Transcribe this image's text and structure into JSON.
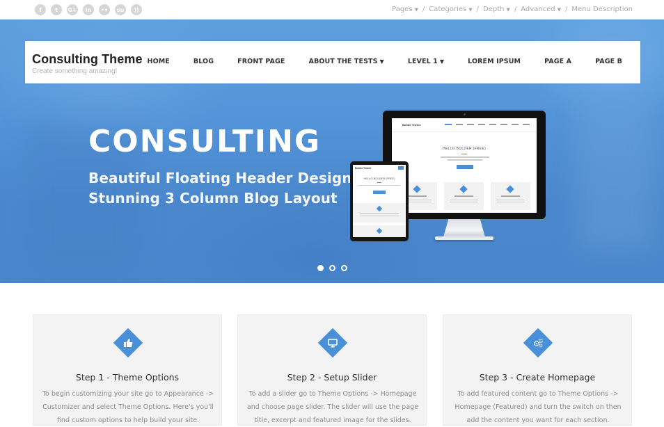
{
  "topbar": {
    "social_icons": [
      {
        "name": "facebook-icon",
        "glyph": "f"
      },
      {
        "name": "twitter-icon",
        "glyph": "t"
      },
      {
        "name": "google-plus-icon",
        "glyph": "G+"
      },
      {
        "name": "linkedin-icon",
        "glyph": "in"
      },
      {
        "name": "flickr-icon",
        "glyph": "••"
      },
      {
        "name": "stumbleupon-icon",
        "glyph": "su"
      },
      {
        "name": "rss-icon",
        "glyph": "))"
      }
    ],
    "menu": [
      {
        "label": "Pages",
        "has_dropdown": true
      },
      {
        "label": "Categories",
        "has_dropdown": true
      },
      {
        "label": "Depth",
        "has_dropdown": true
      },
      {
        "label": "Advanced",
        "has_dropdown": true
      },
      {
        "label": "Menu Description",
        "has_dropdown": false
      }
    ],
    "separator": "/"
  },
  "header": {
    "site_title": "Consulting Theme",
    "tagline": "Create something amazing!",
    "nav": [
      {
        "label": "HOME",
        "has_dropdown": false
      },
      {
        "label": "BLOG",
        "has_dropdown": false
      },
      {
        "label": "FRONT PAGE",
        "has_dropdown": false
      },
      {
        "label": "ABOUT THE TESTS",
        "has_dropdown": true
      },
      {
        "label": "LEVEL 1",
        "has_dropdown": true
      },
      {
        "label": "LOREM IPSUM",
        "has_dropdown": false
      },
      {
        "label": "PAGE A",
        "has_dropdown": false
      },
      {
        "label": "PAGE B",
        "has_dropdown": false
      }
    ]
  },
  "hero": {
    "title": "CONSULTING",
    "line1": "Beautiful Floating Header Design",
    "line2": "Stunning 3 Column Blog Layout",
    "mockup": {
      "brand": "Bolder Theme",
      "headline": "HELLO BOLDER (FREE)"
    },
    "slider": {
      "total": 3,
      "active": 1
    }
  },
  "features": [
    {
      "icon": "thumbs-up-icon",
      "title": "Step 1 - Theme Options",
      "body": "To begin customizing your site go to Appearance -> Customizer and select Theme Options. Here's you'll find custom options to help build your site."
    },
    {
      "icon": "desktop-icon",
      "title": "Step 2 - Setup Slider",
      "body": "To add a slider go to Theme Options -> Homepage and choose page slider. The slider will use the page title, excerpt and featured image for the slides."
    },
    {
      "icon": "gears-icon",
      "title": "Step 3 - Create Homepage",
      "body": "To add featured content go to Theme Options -> Homepage (Featured) and turn the switch on then add the content you want for each section."
    }
  ],
  "colors": {
    "accent": "#4a90d9",
    "hero_bg": "#5494d8",
    "card_bg": "#f3f3f3",
    "nav_text": "#333333",
    "muted_text": "#a9a9a9"
  }
}
